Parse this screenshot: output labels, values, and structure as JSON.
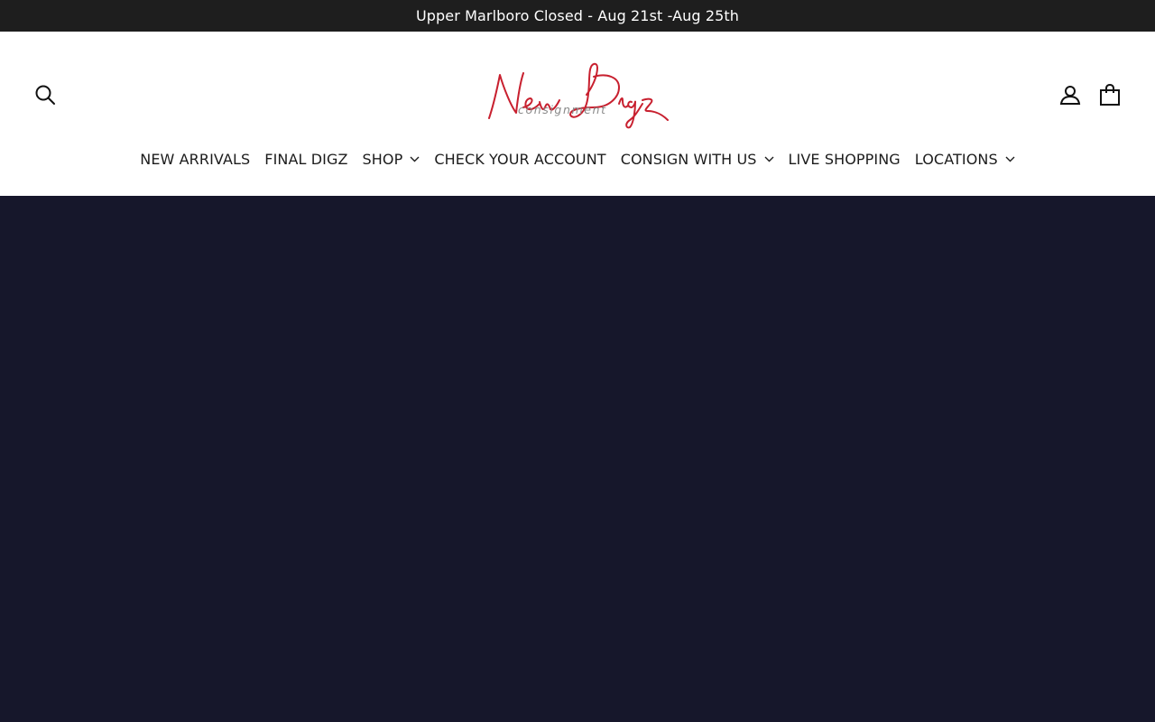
{
  "announcement": {
    "text": "Upper Marlboro Closed - Aug 21st -Aug 25th"
  },
  "header": {
    "logo": {
      "script_text": "New Digz",
      "sub_text": "consignment",
      "primary_color": "#c8202f",
      "secondary_color": "#8a8a8a"
    },
    "icons": {
      "search": "search-icon",
      "account": "user-icon",
      "cart": "bag-icon"
    }
  },
  "nav": {
    "items": [
      {
        "label": "NEW ARRIVALS",
        "has_dropdown": false
      },
      {
        "label": "FINAL DIGZ",
        "has_dropdown": false
      },
      {
        "label": "SHOP",
        "has_dropdown": true
      },
      {
        "label": "CHECK YOUR ACCOUNT",
        "has_dropdown": false
      },
      {
        "label": "CONSIGN WITH US",
        "has_dropdown": true
      },
      {
        "label": "LIVE SHOPPING",
        "has_dropdown": false
      },
      {
        "label": "LOCATIONS",
        "has_dropdown": true
      }
    ]
  },
  "colors": {
    "announcement_bg": "#1e1e1e",
    "hero_bg": "#16172b",
    "nav_text": "#1c1c1c"
  }
}
